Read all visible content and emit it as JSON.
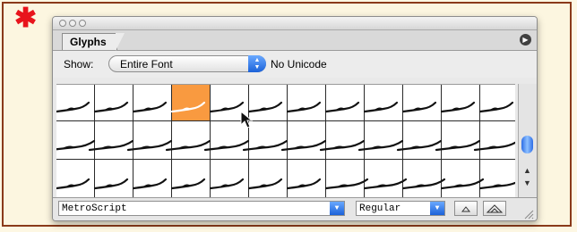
{
  "palette": {
    "tab_label": "Glyphs",
    "show_label": "Show:",
    "show_value": "Entire Font",
    "unicode_label": "No Unicode",
    "font_name": "MetroScript",
    "font_style": "Regular"
  },
  "icons": {
    "decoration": "asterisk-icon",
    "panel_menu": "palette-menu-icon",
    "zoom_out": "zoom-out-icon",
    "zoom_in": "zoom-in-icon"
  },
  "colors": {
    "selected_cell": "#f99a40",
    "accent": "#1c62d8",
    "frame": "#8a3a1a",
    "asterisk": "#e8141c"
  }
}
